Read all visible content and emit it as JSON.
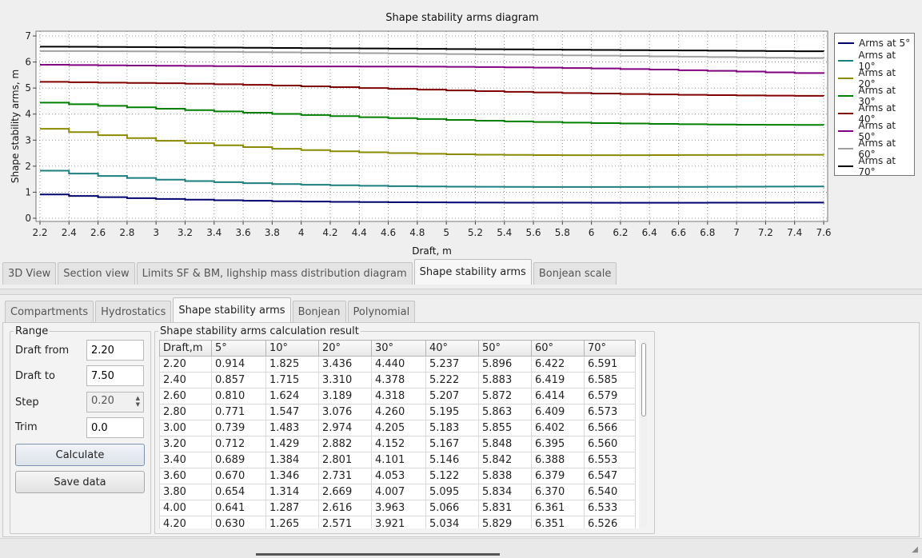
{
  "chart": {
    "title": "Shape stability arms diagram",
    "xlabel": "Draft, m",
    "ylabel": "Shape stability arms, m"
  },
  "chart_data": {
    "type": "line",
    "title": "Shape stability arms diagram",
    "xlabel": "Draft, m",
    "ylabel": "Shape stability arms, m",
    "xlim": [
      2.2,
      7.6
    ],
    "ylim": [
      0,
      7
    ],
    "x_ticks": [
      "2.2",
      "2.4",
      "2.6",
      "2.8",
      "3",
      "3.2",
      "3.4",
      "3.6",
      "3.8",
      "4",
      "4.2",
      "4.4",
      "4.6",
      "4.8",
      "5",
      "5.2",
      "5.4",
      "5.6",
      "5.8",
      "6",
      "6.2",
      "6.4",
      "6.6",
      "6.8",
      "7",
      "7.2",
      "7.4",
      "7.6"
    ],
    "y_ticks": [
      "0",
      "1",
      "2",
      "3",
      "4",
      "5",
      "6",
      "7"
    ],
    "grid": true,
    "legend_position": "right",
    "x": [
      2.2,
      2.4,
      2.6,
      2.8,
      3.0,
      3.2,
      3.4,
      3.6,
      3.8,
      4.0,
      4.2,
      4.4,
      4.6,
      4.8,
      5.0,
      5.2,
      5.4,
      5.6,
      5.8,
      6.0,
      6.2,
      6.4,
      6.6,
      6.8,
      7.0,
      7.2,
      7.4,
      7.6
    ],
    "series": [
      {
        "name": "Arms at 5°",
        "color": "#00006e",
        "values": [
          0.914,
          0.857,
          0.81,
          0.771,
          0.739,
          0.712,
          0.689,
          0.67,
          0.654,
          0.641,
          0.63,
          0.622,
          0.615,
          0.61,
          0.606,
          0.603,
          0.6,
          0.598,
          0.597,
          0.596,
          0.596,
          0.596,
          0.596,
          0.597,
          0.598,
          0.599,
          0.601,
          0.603
        ]
      },
      {
        "name": "Arms at 10°",
        "color": "#1b7f7f",
        "values": [
          1.825,
          1.715,
          1.624,
          1.547,
          1.483,
          1.429,
          1.384,
          1.346,
          1.314,
          1.287,
          1.265,
          1.247,
          1.233,
          1.222,
          1.214,
          1.208,
          1.204,
          1.202,
          1.201,
          1.201,
          1.202,
          1.204,
          1.206,
          1.209,
          1.212,
          1.216,
          1.22,
          1.224
        ]
      },
      {
        "name": "Arms at 20°",
        "color": "#8b8b00",
        "values": [
          3.436,
          3.31,
          3.189,
          3.076,
          2.974,
          2.882,
          2.801,
          2.731,
          2.669,
          2.616,
          2.571,
          2.533,
          2.502,
          2.477,
          2.457,
          2.442,
          2.432,
          2.426,
          2.423,
          2.422,
          2.423,
          2.425,
          2.428,
          2.431,
          2.434,
          2.436,
          2.437,
          2.436
        ]
      },
      {
        "name": "Arms at 30°",
        "color": "#008000",
        "values": [
          4.44,
          4.378,
          4.318,
          4.26,
          4.205,
          4.152,
          4.101,
          4.053,
          4.007,
          3.963,
          3.921,
          3.881,
          3.844,
          3.809,
          3.777,
          3.747,
          3.72,
          3.695,
          3.673,
          3.654,
          3.637,
          3.623,
          3.611,
          3.601,
          3.594,
          3.588,
          3.584,
          3.582
        ]
      },
      {
        "name": "Arms at 40°",
        "color": "#800000",
        "values": [
          5.237,
          5.222,
          5.207,
          5.195,
          5.183,
          5.167,
          5.146,
          5.122,
          5.095,
          5.066,
          5.034,
          5.002,
          4.97,
          4.939,
          4.909,
          4.881,
          4.855,
          4.831,
          4.809,
          4.789,
          4.771,
          4.755,
          4.741,
          4.729,
          4.718,
          4.708,
          4.7,
          4.693
        ]
      },
      {
        "name": "Arms at 50°",
        "color": "#800080",
        "values": [
          5.896,
          5.883,
          5.872,
          5.863,
          5.855,
          5.848,
          5.842,
          5.838,
          5.834,
          5.831,
          5.829,
          5.827,
          5.824,
          5.82,
          5.814,
          5.806,
          5.796,
          5.783,
          5.768,
          5.751,
          5.731,
          5.709,
          5.685,
          5.659,
          5.632,
          5.604,
          5.576,
          5.548
        ]
      },
      {
        "name": "Arms at 60°",
        "color": "#a0a0a0",
        "values": [
          6.422,
          6.419,
          6.414,
          6.409,
          6.402,
          6.395,
          6.388,
          6.379,
          6.37,
          6.361,
          6.351,
          6.34,
          6.329,
          6.318,
          6.306,
          6.294,
          6.282,
          6.27,
          6.257,
          6.244,
          6.231,
          6.218,
          6.205,
          6.192,
          6.178,
          6.165,
          6.152,
          6.139
        ]
      },
      {
        "name": "Arms at 70°",
        "color": "#000000",
        "values": [
          6.591,
          6.585,
          6.579,
          6.573,
          6.566,
          6.56,
          6.553,
          6.547,
          6.54,
          6.533,
          6.526,
          6.519,
          6.512,
          6.505,
          6.498,
          6.491,
          6.484,
          6.477,
          6.47,
          6.463,
          6.456,
          6.449,
          6.442,
          6.435,
          6.428,
          6.421,
          6.414,
          6.407
        ]
      }
    ]
  },
  "top_tabs": [
    {
      "label": "3D View",
      "active": false
    },
    {
      "label": "Section view",
      "active": false
    },
    {
      "label": "Limits SF & BM, lighship mass distribution diagram",
      "active": false
    },
    {
      "label": "Shape stability arms",
      "active": true
    },
    {
      "label": "Bonjean scale",
      "active": false
    }
  ],
  "inner_tabs": [
    {
      "label": "Compartments",
      "active": false
    },
    {
      "label": "Hydrostatics",
      "active": false
    },
    {
      "label": "Shape stability arms",
      "active": true
    },
    {
      "label": "Bonjean",
      "active": false
    },
    {
      "label": "Polynomial",
      "active": false
    }
  ],
  "range": {
    "title": "Range",
    "draft_from_label": "Draft from",
    "draft_from_value": "2.20",
    "draft_to_label": "Draft to",
    "draft_to_value": "7.50",
    "step_label": "Step",
    "step_value": "0.20",
    "trim_label": "Trim",
    "trim_value": "0.0",
    "calculate_label": "Calculate",
    "save_label": "Save data"
  },
  "result": {
    "title": "Shape stability arms calculation result",
    "columns": [
      "Draft,m",
      "5°",
      "10°",
      "20°",
      "30°",
      "40°",
      "50°",
      "60°",
      "70°"
    ],
    "rows": [
      [
        "2.20",
        "0.914",
        "1.825",
        "3.436",
        "4.440",
        "5.237",
        "5.896",
        "6.422",
        "6.591"
      ],
      [
        "2.40",
        "0.857",
        "1.715",
        "3.310",
        "4.378",
        "5.222",
        "5.883",
        "6.419",
        "6.585"
      ],
      [
        "2.60",
        "0.810",
        "1.624",
        "3.189",
        "4.318",
        "5.207",
        "5.872",
        "6.414",
        "6.579"
      ],
      [
        "2.80",
        "0.771",
        "1.547",
        "3.076",
        "4.260",
        "5.195",
        "5.863",
        "6.409",
        "6.573"
      ],
      [
        "3.00",
        "0.739",
        "1.483",
        "2.974",
        "4.205",
        "5.183",
        "5.855",
        "6.402",
        "6.566"
      ],
      [
        "3.20",
        "0.712",
        "1.429",
        "2.882",
        "4.152",
        "5.167",
        "5.848",
        "6.395",
        "6.560"
      ],
      [
        "3.40",
        "0.689",
        "1.384",
        "2.801",
        "4.101",
        "5.146",
        "5.842",
        "6.388",
        "6.553"
      ],
      [
        "3.60",
        "0.670",
        "1.346",
        "2.731",
        "4.053",
        "5.122",
        "5.838",
        "6.379",
        "6.547"
      ],
      [
        "3.80",
        "0.654",
        "1.314",
        "2.669",
        "4.007",
        "5.095",
        "5.834",
        "6.370",
        "6.540"
      ],
      [
        "4.00",
        "0.641",
        "1.287",
        "2.616",
        "3.963",
        "5.066",
        "5.831",
        "6.361",
        "6.533"
      ],
      [
        "4.20",
        "0.630",
        "1.265",
        "2.571",
        "3.921",
        "5.034",
        "5.829",
        "6.351",
        "6.526"
      ]
    ]
  }
}
